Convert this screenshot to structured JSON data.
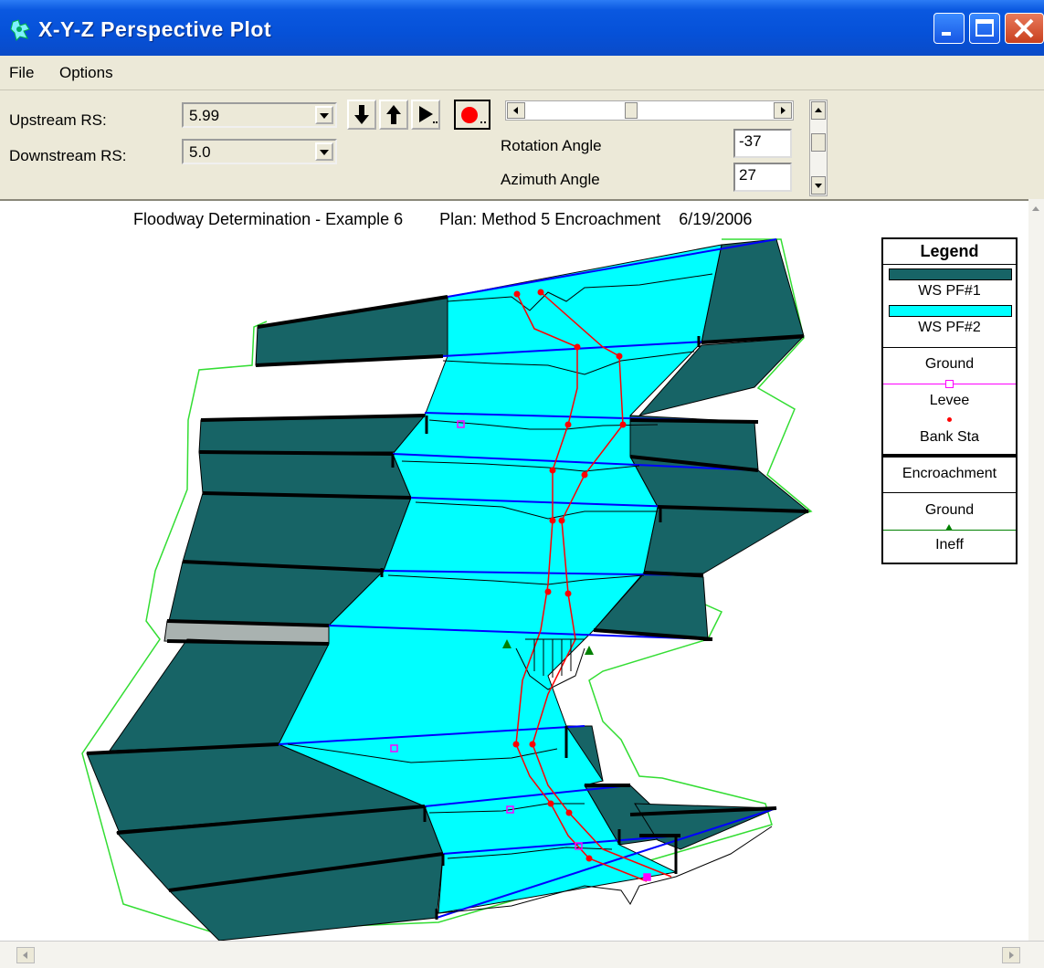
{
  "window": {
    "title": "X-Y-Z Perspective Plot"
  },
  "menu": {
    "file": "File",
    "options": "Options"
  },
  "controls": {
    "upstream_label": "Upstream RS:",
    "upstream_value": "5.99",
    "downstream_label": "Downstream RS:",
    "downstream_value": "5.0",
    "rotation_label": "Rotation Angle",
    "rotation_value": "-37",
    "azimuth_label": "Azimuth Angle",
    "azimuth_value": "27"
  },
  "toolbar_icons": [
    "arrow-down-icon",
    "arrow-up-icon",
    "play-icon",
    "record-icon"
  ],
  "plot": {
    "title": "Floodway Determination - Example 6        Plan: Method 5 Encroachment    6/19/2006",
    "colors": {
      "ws_pf1": "#176466",
      "ws_pf2": "#00ffff",
      "ground": "#000000",
      "levee": "#ff00ff",
      "bank_sta": "#ff0000",
      "encroachment": "#000000",
      "ineff": "#008000"
    }
  },
  "legend": {
    "title": "Legend",
    "items": [
      "WS PF#1",
      "WS PF#2",
      "Ground",
      "Levee",
      "Bank Sta",
      "Encroachment",
      "Ground",
      "Ineff"
    ]
  }
}
